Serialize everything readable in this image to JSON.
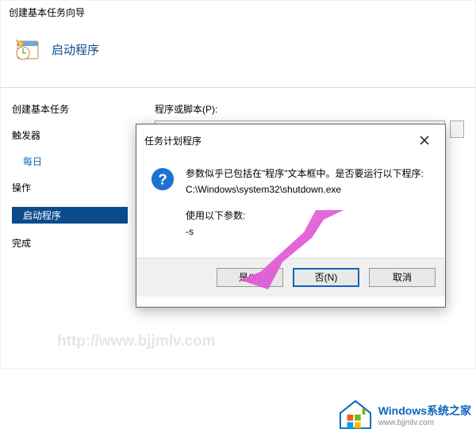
{
  "wizard": {
    "window_title": "创建基本任务向导",
    "heading": "启动程序",
    "steps": {
      "group1": "创建基本任务",
      "trigger": "触发器",
      "trigger_item": "每日",
      "action": "操作",
      "action_item": "启动程序",
      "finish": "完成"
    },
    "content": {
      "program_label": "程序或脚本(P):"
    }
  },
  "dialog": {
    "title": "任务计划程序",
    "line1": "参数似乎已包括在\"程序\"文本框中。是否要运行以下程序:",
    "line2": "C:\\Windows\\system32\\shutdown.exe",
    "line3": "使用以下参数:",
    "line4": "-s",
    "btn_yes": "是(Y)",
    "btn_no": "否(N)",
    "btn_cancel": "取消"
  },
  "watermarks": {
    "center": "http://www.bjjmlv.com",
    "logo_title": "Windows系统之家",
    "logo_url": "www.bjjmlv.com"
  }
}
